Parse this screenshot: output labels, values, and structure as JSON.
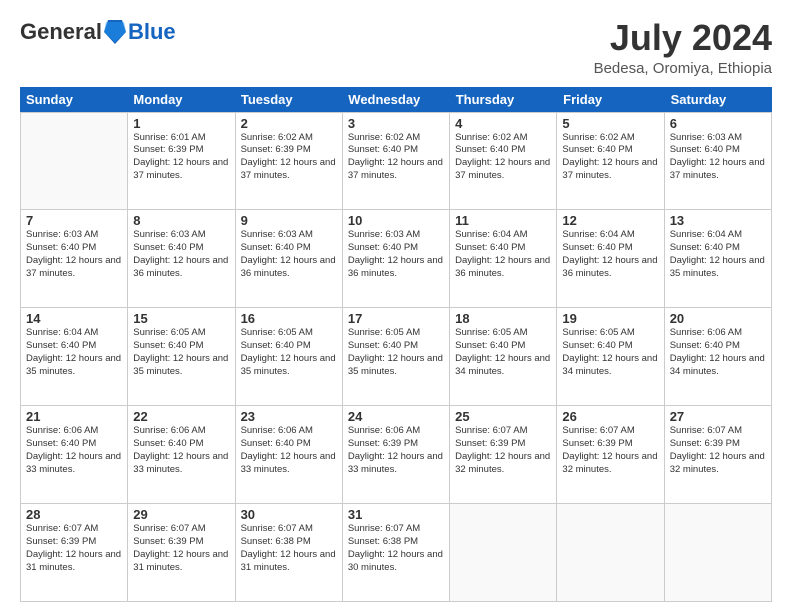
{
  "header": {
    "logo_general": "General",
    "logo_blue": "Blue",
    "month_title": "July 2024",
    "location": "Bedesa, Oromiya, Ethiopia"
  },
  "weekdays": [
    "Sunday",
    "Monday",
    "Tuesday",
    "Wednesday",
    "Thursday",
    "Friday",
    "Saturday"
  ],
  "weeks": [
    [
      {
        "day": "",
        "sunrise": "",
        "sunset": "",
        "daylight": ""
      },
      {
        "day": "1",
        "sunrise": "Sunrise: 6:01 AM",
        "sunset": "Sunset: 6:39 PM",
        "daylight": "Daylight: 12 hours and 37 minutes."
      },
      {
        "day": "2",
        "sunrise": "Sunrise: 6:02 AM",
        "sunset": "Sunset: 6:39 PM",
        "daylight": "Daylight: 12 hours and 37 minutes."
      },
      {
        "day": "3",
        "sunrise": "Sunrise: 6:02 AM",
        "sunset": "Sunset: 6:40 PM",
        "daylight": "Daylight: 12 hours and 37 minutes."
      },
      {
        "day": "4",
        "sunrise": "Sunrise: 6:02 AM",
        "sunset": "Sunset: 6:40 PM",
        "daylight": "Daylight: 12 hours and 37 minutes."
      },
      {
        "day": "5",
        "sunrise": "Sunrise: 6:02 AM",
        "sunset": "Sunset: 6:40 PM",
        "daylight": "Daylight: 12 hours and 37 minutes."
      },
      {
        "day": "6",
        "sunrise": "Sunrise: 6:03 AM",
        "sunset": "Sunset: 6:40 PM",
        "daylight": "Daylight: 12 hours and 37 minutes."
      }
    ],
    [
      {
        "day": "7",
        "sunrise": "Sunrise: 6:03 AM",
        "sunset": "Sunset: 6:40 PM",
        "daylight": "Daylight: 12 hours and 37 minutes."
      },
      {
        "day": "8",
        "sunrise": "Sunrise: 6:03 AM",
        "sunset": "Sunset: 6:40 PM",
        "daylight": "Daylight: 12 hours and 36 minutes."
      },
      {
        "day": "9",
        "sunrise": "Sunrise: 6:03 AM",
        "sunset": "Sunset: 6:40 PM",
        "daylight": "Daylight: 12 hours and 36 minutes."
      },
      {
        "day": "10",
        "sunrise": "Sunrise: 6:03 AM",
        "sunset": "Sunset: 6:40 PM",
        "daylight": "Daylight: 12 hours and 36 minutes."
      },
      {
        "day": "11",
        "sunrise": "Sunrise: 6:04 AM",
        "sunset": "Sunset: 6:40 PM",
        "daylight": "Daylight: 12 hours and 36 minutes."
      },
      {
        "day": "12",
        "sunrise": "Sunrise: 6:04 AM",
        "sunset": "Sunset: 6:40 PM",
        "daylight": "Daylight: 12 hours and 36 minutes."
      },
      {
        "day": "13",
        "sunrise": "Sunrise: 6:04 AM",
        "sunset": "Sunset: 6:40 PM",
        "daylight": "Daylight: 12 hours and 35 minutes."
      }
    ],
    [
      {
        "day": "14",
        "sunrise": "Sunrise: 6:04 AM",
        "sunset": "Sunset: 6:40 PM",
        "daylight": "Daylight: 12 hours and 35 minutes."
      },
      {
        "day": "15",
        "sunrise": "Sunrise: 6:05 AM",
        "sunset": "Sunset: 6:40 PM",
        "daylight": "Daylight: 12 hours and 35 minutes."
      },
      {
        "day": "16",
        "sunrise": "Sunrise: 6:05 AM",
        "sunset": "Sunset: 6:40 PM",
        "daylight": "Daylight: 12 hours and 35 minutes."
      },
      {
        "day": "17",
        "sunrise": "Sunrise: 6:05 AM",
        "sunset": "Sunset: 6:40 PM",
        "daylight": "Daylight: 12 hours and 35 minutes."
      },
      {
        "day": "18",
        "sunrise": "Sunrise: 6:05 AM",
        "sunset": "Sunset: 6:40 PM",
        "daylight": "Daylight: 12 hours and 34 minutes."
      },
      {
        "day": "19",
        "sunrise": "Sunrise: 6:05 AM",
        "sunset": "Sunset: 6:40 PM",
        "daylight": "Daylight: 12 hours and 34 minutes."
      },
      {
        "day": "20",
        "sunrise": "Sunrise: 6:06 AM",
        "sunset": "Sunset: 6:40 PM",
        "daylight": "Daylight: 12 hours and 34 minutes."
      }
    ],
    [
      {
        "day": "21",
        "sunrise": "Sunrise: 6:06 AM",
        "sunset": "Sunset: 6:40 PM",
        "daylight": "Daylight: 12 hours and 33 minutes."
      },
      {
        "day": "22",
        "sunrise": "Sunrise: 6:06 AM",
        "sunset": "Sunset: 6:40 PM",
        "daylight": "Daylight: 12 hours and 33 minutes."
      },
      {
        "day": "23",
        "sunrise": "Sunrise: 6:06 AM",
        "sunset": "Sunset: 6:40 PM",
        "daylight": "Daylight: 12 hours and 33 minutes."
      },
      {
        "day": "24",
        "sunrise": "Sunrise: 6:06 AM",
        "sunset": "Sunset: 6:39 PM",
        "daylight": "Daylight: 12 hours and 33 minutes."
      },
      {
        "day": "25",
        "sunrise": "Sunrise: 6:07 AM",
        "sunset": "Sunset: 6:39 PM",
        "daylight": "Daylight: 12 hours and 32 minutes."
      },
      {
        "day": "26",
        "sunrise": "Sunrise: 6:07 AM",
        "sunset": "Sunset: 6:39 PM",
        "daylight": "Daylight: 12 hours and 32 minutes."
      },
      {
        "day": "27",
        "sunrise": "Sunrise: 6:07 AM",
        "sunset": "Sunset: 6:39 PM",
        "daylight": "Daylight: 12 hours and 32 minutes."
      }
    ],
    [
      {
        "day": "28",
        "sunrise": "Sunrise: 6:07 AM",
        "sunset": "Sunset: 6:39 PM",
        "daylight": "Daylight: 12 hours and 31 minutes."
      },
      {
        "day": "29",
        "sunrise": "Sunrise: 6:07 AM",
        "sunset": "Sunset: 6:39 PM",
        "daylight": "Daylight: 12 hours and 31 minutes."
      },
      {
        "day": "30",
        "sunrise": "Sunrise: 6:07 AM",
        "sunset": "Sunset: 6:38 PM",
        "daylight": "Daylight: 12 hours and 31 minutes."
      },
      {
        "day": "31",
        "sunrise": "Sunrise: 6:07 AM",
        "sunset": "Sunset: 6:38 PM",
        "daylight": "Daylight: 12 hours and 30 minutes."
      },
      {
        "day": "",
        "sunrise": "",
        "sunset": "",
        "daylight": ""
      },
      {
        "day": "",
        "sunrise": "",
        "sunset": "",
        "daylight": ""
      },
      {
        "day": "",
        "sunrise": "",
        "sunset": "",
        "daylight": ""
      }
    ]
  ]
}
